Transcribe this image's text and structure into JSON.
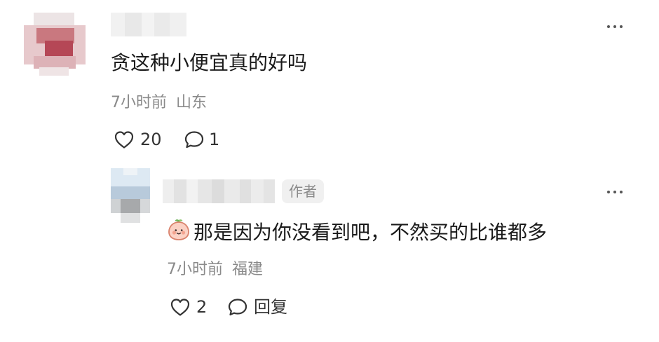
{
  "comments": [
    {
      "text": "贪这种小便宜真的好吗",
      "time": "7小时前",
      "location": "山东",
      "likes": "20",
      "replies": "1",
      "icons": {
        "like": "heart-outline-icon",
        "reply": "chat-bubble-icon",
        "more": "more-dots-icon"
      }
    }
  ],
  "reply": {
    "badge": "作者",
    "emoji": "peach-face-emoji",
    "text": "那是因为你没看到吧，不然买的比谁都多",
    "time": "7小时前",
    "location": "福建",
    "likes": "2",
    "reply_label": "回复",
    "icons": {
      "like": "heart-outline-icon",
      "reply": "chat-bubble-icon",
      "more": "more-dots-icon"
    }
  },
  "colors": {
    "text_primary": "#1a1a1a",
    "text_secondary": "#8a8a8a",
    "badge_bg": "#f0f0f0",
    "background": "#ffffff"
  }
}
